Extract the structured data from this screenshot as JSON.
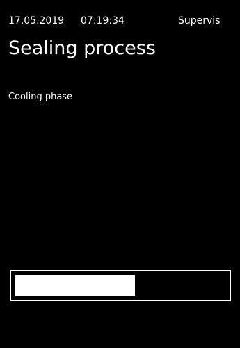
{
  "status_bar": {
    "date": "17.05.2019",
    "time": "07:19:34",
    "user": "Supervis"
  },
  "title": "Sealing process",
  "phase": "Cooling phase",
  "progress": {
    "fraction": 0.57
  },
  "colors": {
    "background": "#000000",
    "foreground": "#ffffff"
  }
}
